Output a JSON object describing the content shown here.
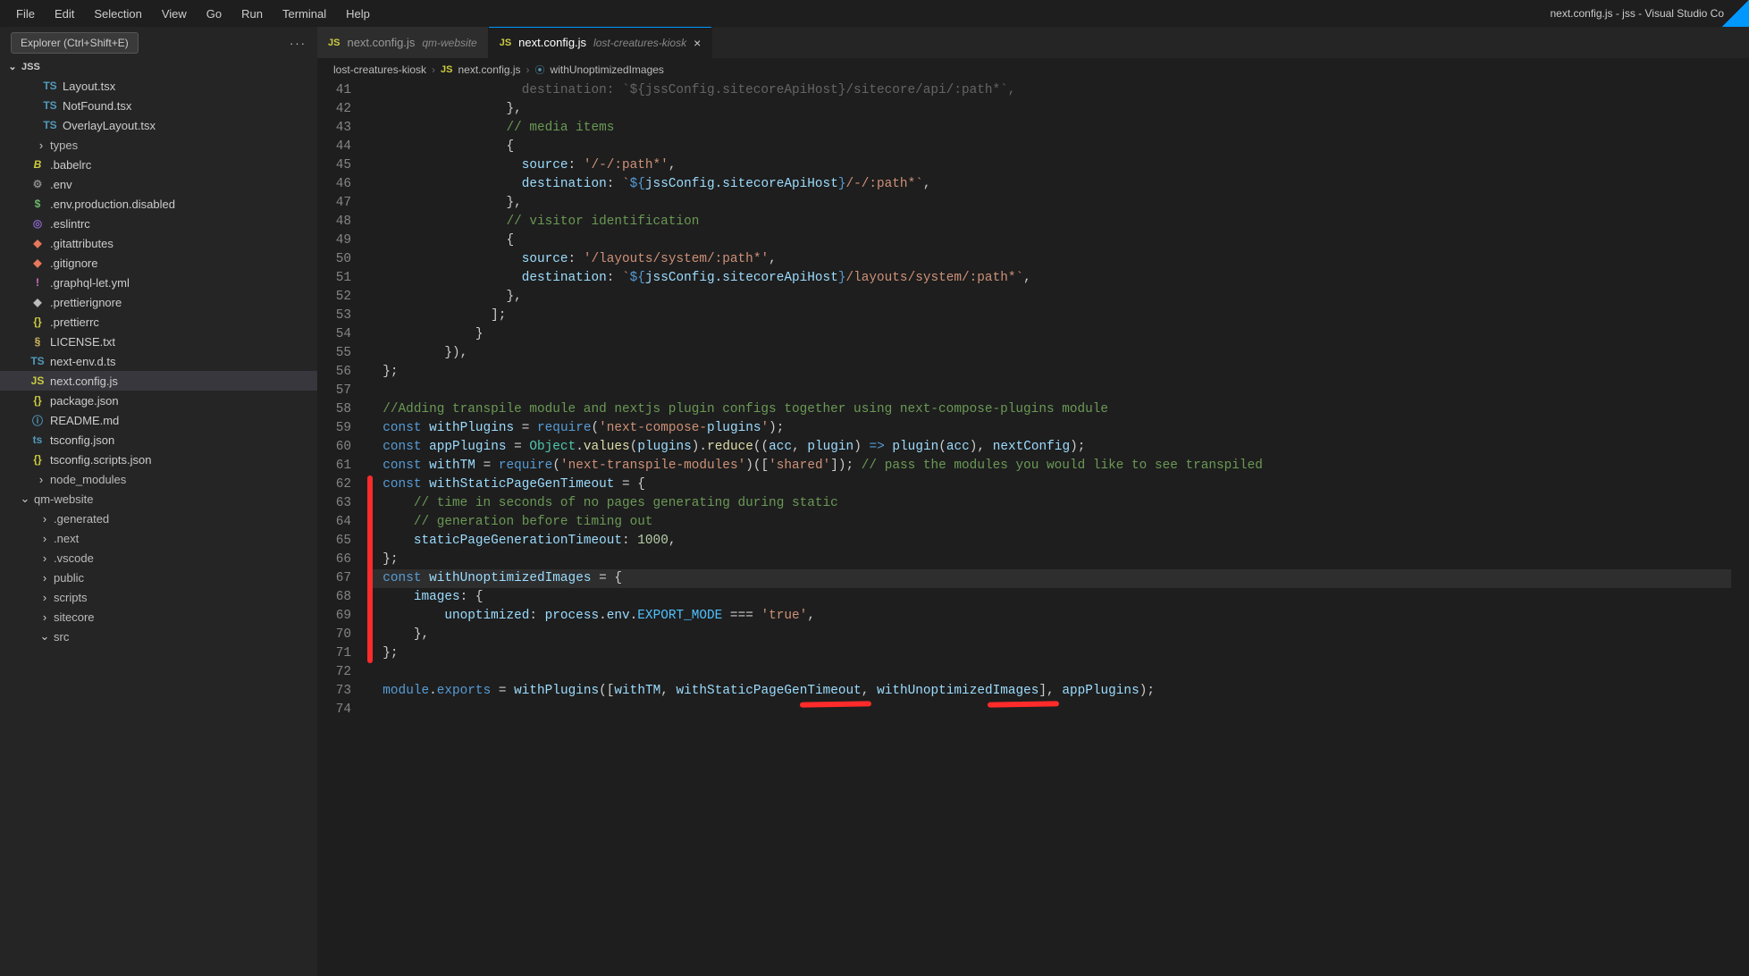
{
  "window": {
    "title": "next.config.js - jss - Visual Studio Co"
  },
  "menu": [
    "File",
    "Edit",
    "Selection",
    "View",
    "Go",
    "Run",
    "Terminal",
    "Help"
  ],
  "explorer": {
    "pill": "Explorer (Ctrl+Shift+E)",
    "project": "JSS"
  },
  "files": [
    {
      "icon": "TS",
      "cls": "ic-ts",
      "name": "Layout.tsx",
      "indent": 34
    },
    {
      "icon": "TS",
      "cls": "ic-ts",
      "name": "NotFound.tsx",
      "indent": 34
    },
    {
      "icon": "TS",
      "cls": "ic-ts",
      "name": "OverlayLayout.tsx",
      "indent": 34
    }
  ],
  "folders1": [
    {
      "name": "types"
    }
  ],
  "files2": [
    {
      "icon": "B",
      "cls": "ic-babel",
      "name": ".babelrc"
    },
    {
      "icon": "⚙",
      "cls": "ic-env",
      "name": ".env"
    },
    {
      "icon": "$",
      "cls": "ic-dollar",
      "name": ".env.production.disabled"
    },
    {
      "icon": "◎",
      "cls": "ic-eslint",
      "name": ".eslintrc"
    },
    {
      "icon": "◆",
      "cls": "ic-git",
      "name": ".gitattributes"
    },
    {
      "icon": "◆",
      "cls": "ic-git",
      "name": ".gitignore"
    },
    {
      "icon": "!",
      "cls": "ic-exc",
      "name": ".graphql-let.yml"
    },
    {
      "icon": "◆",
      "cls": "ic-pret",
      "name": ".prettierignore"
    },
    {
      "icon": "{}",
      "cls": "ic-json",
      "name": ".prettierrc"
    },
    {
      "icon": "§",
      "cls": "ic-lic",
      "name": "LICENSE.txt"
    },
    {
      "icon": "TS",
      "cls": "ic-ts",
      "name": "next-env.d.ts"
    },
    {
      "icon": "JS",
      "cls": "ic-js",
      "name": "next.config.js",
      "selected": true
    },
    {
      "icon": "{}",
      "cls": "ic-json",
      "name": "package.json"
    },
    {
      "icon": "ⓘ",
      "cls": "ic-md",
      "name": "README.md"
    },
    {
      "icon": "ts",
      "cls": "ic-ts",
      "name": "tsconfig.json"
    },
    {
      "icon": "{}",
      "cls": "ic-json",
      "name": "tsconfig.scripts.json"
    }
  ],
  "folders2": [
    {
      "chev": "›",
      "name": "node_modules"
    }
  ],
  "qmwebsite": {
    "header": "qm-website",
    "children": [
      "​.generated",
      ".next",
      ".vscode",
      "public",
      "scripts",
      "sitecore"
    ],
    "src": "src"
  },
  "tabs": [
    {
      "file": "next.config.js",
      "sub": "qm-website",
      "active": false
    },
    {
      "file": "next.config.js",
      "sub": "lost-creatures-kiosk",
      "active": true,
      "close": true
    }
  ],
  "breadcrumb": {
    "a": "lost-creatures-kiosk",
    "b": "next.config.js",
    "c": "withUnoptimizedImages"
  },
  "chart_data": null,
  "code": {
    "start": 41,
    "lines": [
      {
        "n": 41,
        "raw": "                    destination: `${jssConfig.sitecoreApiHost}/sitecore/api/:path*`,",
        "dim": true
      },
      {
        "n": 42,
        "raw": "                  },"
      },
      {
        "n": 43,
        "raw": "                  // media items",
        "comment": true
      },
      {
        "n": 44,
        "raw": "                  {"
      },
      {
        "n": 45,
        "raw": "                    source: '/-/:path*',"
      },
      {
        "n": 46,
        "raw": "                    destination: `${jssConfig.sitecoreApiHost}/-/:path*`,"
      },
      {
        "n": 47,
        "raw": "                  },"
      },
      {
        "n": 48,
        "raw": "                  // visitor identification",
        "comment": true
      },
      {
        "n": 49,
        "raw": "                  {"
      },
      {
        "n": 50,
        "raw": "                    source: '/layouts/system/:path*',"
      },
      {
        "n": 51,
        "raw": "                    destination: `${jssConfig.sitecoreApiHost}/layouts/system/:path*`,"
      },
      {
        "n": 52,
        "raw": "                  },"
      },
      {
        "n": 53,
        "raw": "                ];"
      },
      {
        "n": 54,
        "raw": "              }"
      },
      {
        "n": 55,
        "raw": "          }),"
      },
      {
        "n": 56,
        "raw": "  };"
      },
      {
        "n": 57,
        "raw": ""
      },
      {
        "n": 58,
        "raw": "  //Adding transpile module and nextjs plugin configs together using next-compose-plugins module",
        "comment": true
      },
      {
        "n": 59,
        "raw": "  const withPlugins = require('next-compose-plugins');"
      },
      {
        "n": 60,
        "raw": "  const appPlugins = Object.values(plugins).reduce((acc, plugin) => plugin(acc), nextConfig);"
      },
      {
        "n": 61,
        "raw": "  const withTM = require('next-transpile-modules')(['shared']); // pass the modules you would like to see transpiled"
      },
      {
        "n": 62,
        "raw": "  const withStaticPageGenTimeout = {"
      },
      {
        "n": 63,
        "raw": "      // time in seconds of no pages generating during static",
        "comment": true
      },
      {
        "n": 64,
        "raw": "      // generation before timing out",
        "comment": true
      },
      {
        "n": 65,
        "raw": "      staticPageGenerationTimeout: 1000,"
      },
      {
        "n": 66,
        "raw": "  };"
      },
      {
        "n": 67,
        "raw": "  const withUnoptimizedImages = {",
        "hl": true
      },
      {
        "n": 68,
        "raw": "      images: {"
      },
      {
        "n": 69,
        "raw": "          unoptimized: process.env.EXPORT_MODE === 'true',"
      },
      {
        "n": 70,
        "raw": "      },"
      },
      {
        "n": 71,
        "raw": "  };"
      },
      {
        "n": 72,
        "raw": ""
      },
      {
        "n": 73,
        "raw": "  module.exports = withPlugins([withTM, withStaticPageGenTimeout, withUnoptimizedImages], appPlugins);"
      },
      {
        "n": 74,
        "raw": ""
      }
    ]
  }
}
